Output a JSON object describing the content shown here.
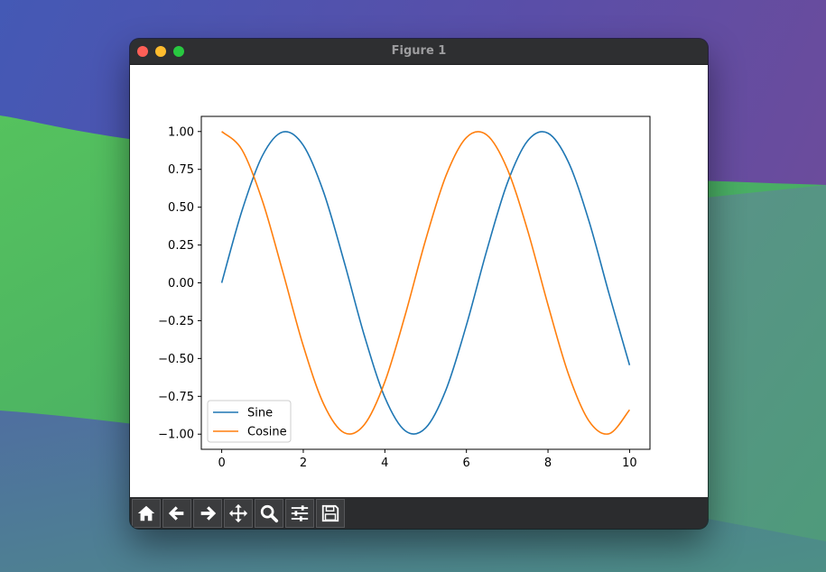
{
  "window": {
    "title": "Figure 1"
  },
  "toolbar": {
    "buttons": [
      {
        "name": "home-button",
        "icon": "home-icon"
      },
      {
        "name": "back-button",
        "icon": "arrow-left-icon"
      },
      {
        "name": "forward-button",
        "icon": "arrow-right-icon"
      },
      {
        "name": "pan-button",
        "icon": "move-icon"
      },
      {
        "name": "zoom-button",
        "icon": "magnifier-icon"
      },
      {
        "name": "configure-subplots-button",
        "icon": "sliders-icon"
      },
      {
        "name": "save-button",
        "icon": "floppy-disk-icon"
      }
    ]
  },
  "chart_data": {
    "type": "line",
    "title": "",
    "xlabel": "",
    "ylabel": "",
    "xlim": [
      -0.5,
      10.5
    ],
    "ylim": [
      -1.1,
      1.1
    ],
    "xticks": [
      0,
      2,
      4,
      6,
      8,
      10
    ],
    "xtick_labels": [
      "0",
      "2",
      "4",
      "6",
      "8",
      "10"
    ],
    "yticks": [
      1.0,
      0.75,
      0.5,
      0.25,
      0.0,
      -0.25,
      -0.5,
      -0.75,
      -1.0
    ],
    "ytick_labels": [
      "1.00",
      "0.75",
      "0.50",
      "0.25",
      "0.00",
      "−0.25",
      "−0.50",
      "−0.75",
      "−1.00"
    ],
    "grid": false,
    "legend_position": "lower-left",
    "x": [
      0,
      0.5,
      1,
      1.5,
      2,
      2.5,
      3,
      3.5,
      4,
      4.5,
      5,
      5.5,
      6,
      6.5,
      7,
      7.5,
      8,
      8.5,
      9,
      9.5,
      10
    ],
    "series": [
      {
        "name": "Sine",
        "color": "#1f77b4",
        "values": [
          0.0,
          0.479,
          0.841,
          0.997,
          0.909,
          0.598,
          0.141,
          -0.351,
          -0.757,
          -0.978,
          -0.959,
          -0.706,
          -0.279,
          0.215,
          0.657,
          0.938,
          0.989,
          0.798,
          0.412,
          -0.075,
          -0.544
        ]
      },
      {
        "name": "Cosine",
        "color": "#ff7f0e",
        "values": [
          1.0,
          0.878,
          0.54,
          0.071,
          -0.416,
          -0.801,
          -0.99,
          -0.936,
          -0.654,
          -0.211,
          0.284,
          0.709,
          0.96,
          0.977,
          0.754,
          0.347,
          -0.146,
          -0.602,
          -0.911,
          -0.997,
          -0.839
        ]
      }
    ]
  }
}
